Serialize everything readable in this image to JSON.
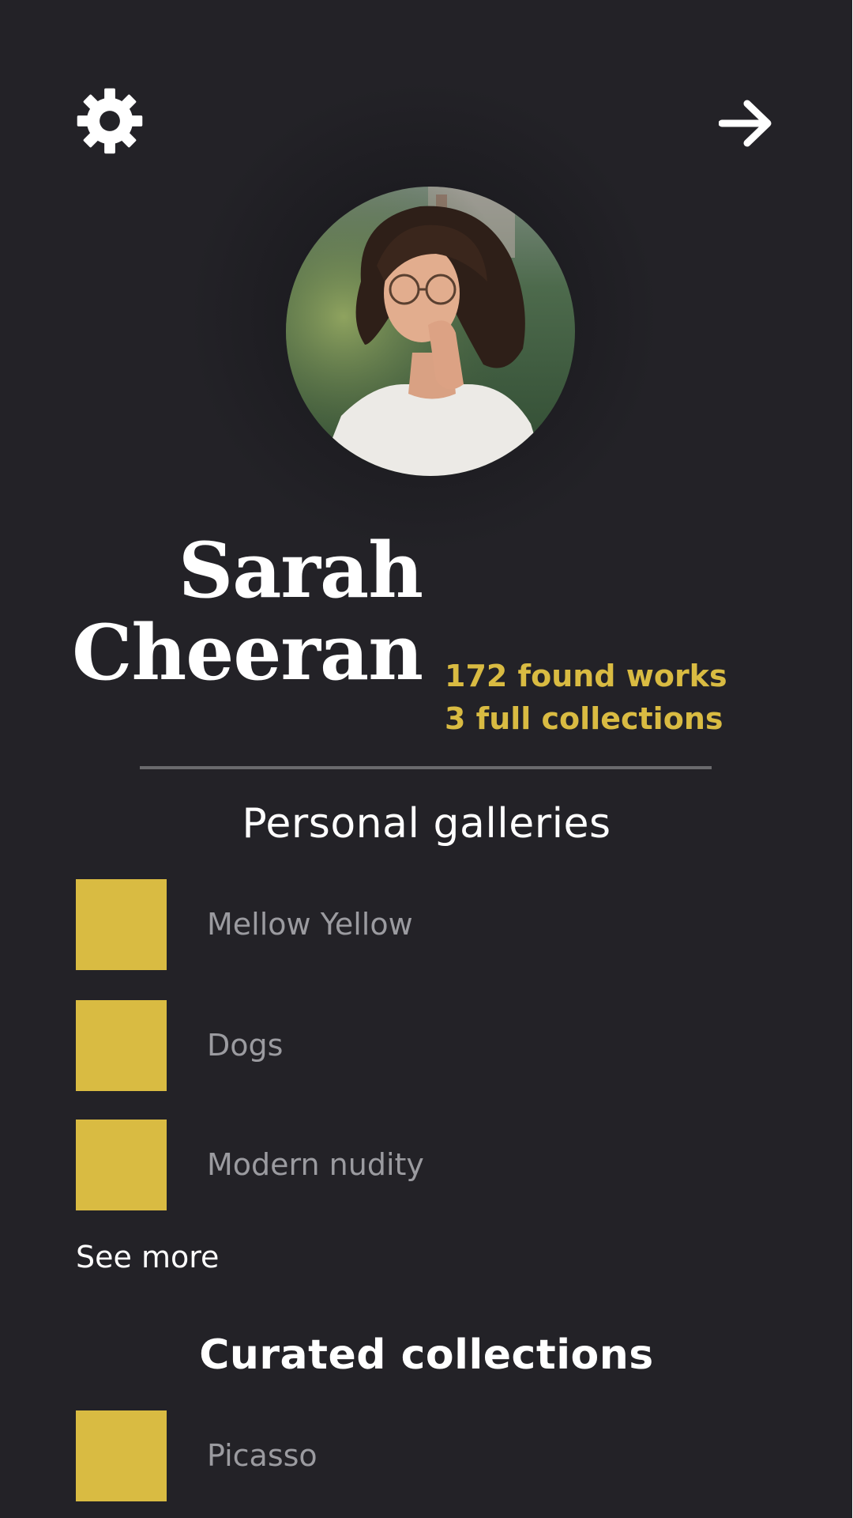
{
  "header": {
    "settings_icon": "gear-icon",
    "next_icon": "arrow-right-icon"
  },
  "profile": {
    "first_name": "Sarah",
    "last_name": "Cheeran",
    "found_works": "172 found works",
    "full_collections": "3 full collections"
  },
  "personal_galleries": {
    "title": "Personal galleries",
    "items": [
      {
        "label": "Mellow Yellow"
      },
      {
        "label": "Dogs"
      },
      {
        "label": "Modern nudity"
      }
    ],
    "see_more": "See more"
  },
  "curated_collections": {
    "title": "Curated collections",
    "items": [
      {
        "label": "Picasso"
      }
    ]
  },
  "colors": {
    "background": "#232227",
    "accent": "#d9bb42",
    "muted_text": "#9b9ba0",
    "divider": "#6a6a6d"
  }
}
